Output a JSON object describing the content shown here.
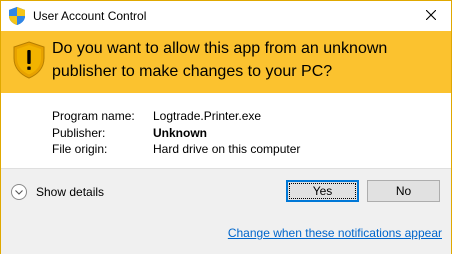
{
  "window": {
    "title": "User Account Control"
  },
  "banner": {
    "message": "Do you want to allow this app from an unknown publisher to make changes to your PC?"
  },
  "details": {
    "program_name_label": "Program name:",
    "program_name_value": "Logtrade.Printer.exe",
    "publisher_label": "Publisher:",
    "publisher_value": "Unknown",
    "file_origin_label": "File origin:",
    "file_origin_value": "Hard drive on this computer"
  },
  "footer": {
    "show_details_label": "Show details",
    "yes_label": "Yes",
    "no_label": "No",
    "notifications_link": "Change when these notifications appear"
  },
  "colors": {
    "banner_bg": "#fbc22f",
    "accent": "#0078d7",
    "link": "#0066cc",
    "footer_bg": "#f0f0f0"
  },
  "icons": {
    "title_icon": "uac-shield-icon",
    "banner_icon": "warning-shield-icon",
    "close_icon": "close-icon",
    "details_icon": "chevron-down-icon"
  }
}
